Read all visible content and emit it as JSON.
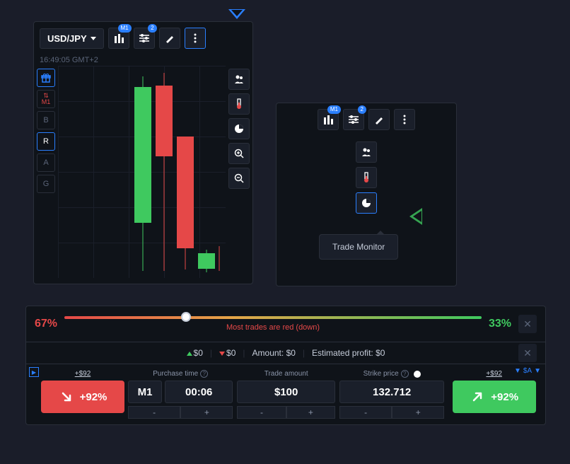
{
  "chart": {
    "pair": "USD/JPY",
    "timestamp": "16:49:05 GMT+2",
    "toolbar": {
      "badges": {
        "candles": "M1",
        "indicators": "2"
      }
    },
    "left_tools": {
      "m1_label": "M1",
      "b": "B",
      "r": "R",
      "a": "A",
      "g": "G"
    }
  },
  "secondary": {
    "toolbar": {
      "badges": {
        "candles": "M1",
        "indicators": "2"
      }
    },
    "tooltip": "Trade Monitor"
  },
  "sentiment": {
    "left_pct": "67%",
    "right_pct": "33%",
    "label": "Most trades are red (down)"
  },
  "summary": {
    "up_value": "$0",
    "down_value": "$0",
    "amount_label": "Amount:",
    "amount_value": "$0",
    "profit_label": "Estimated profit:",
    "profit_value": "$0"
  },
  "trade": {
    "sell": {
      "top": "+$92",
      "pct": "+92%"
    },
    "buy": {
      "top": "+$92",
      "pct": "+92%"
    },
    "purchase_time": {
      "label": "Purchase time",
      "interval": "M1",
      "countdown": "00:06"
    },
    "amount": {
      "label": "Trade amount",
      "value": "$100"
    },
    "strike": {
      "label": "Strike price",
      "value": "132.712"
    },
    "top_right": "$A"
  }
}
